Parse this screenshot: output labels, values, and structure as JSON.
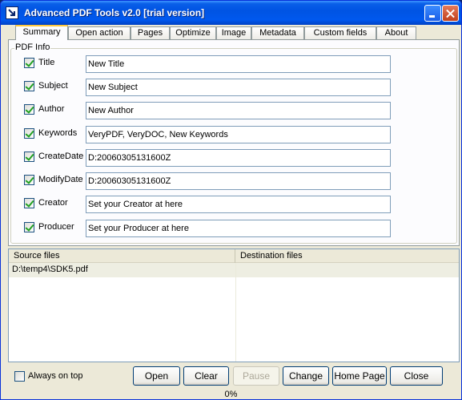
{
  "window": {
    "title": "Advanced PDF Tools  v2.0 [trial version]",
    "icons": [
      "app-icon",
      "minimize-icon",
      "close-icon"
    ]
  },
  "tabs": [
    {
      "label": "Summary",
      "active": true
    },
    {
      "label": "Open action",
      "active": false
    },
    {
      "label": "Pages",
      "active": false
    },
    {
      "label": "Optimize",
      "active": false
    },
    {
      "label": "Image",
      "active": false
    },
    {
      "label": "Metadata",
      "active": false
    },
    {
      "label": "Custom fields",
      "active": false
    },
    {
      "label": "About",
      "active": false
    }
  ],
  "pdf_info": {
    "legend": "PDF Info",
    "fields": [
      {
        "label": "Title",
        "checked": true,
        "value": "New Title"
      },
      {
        "label": "Subject",
        "checked": true,
        "value": "New Subject"
      },
      {
        "label": "Author",
        "checked": true,
        "value": "New Author"
      },
      {
        "label": "Keywords",
        "checked": true,
        "value": "VeryPDF, VeryDOC, New Keywords"
      },
      {
        "label": "CreateDate",
        "checked": true,
        "value": "D:20060305131600Z"
      },
      {
        "label": "ModifyDate",
        "checked": true,
        "value": "D:20060305131600Z"
      },
      {
        "label": "Creator",
        "checked": true,
        "value": "Set your Creator at here"
      },
      {
        "label": "Producer",
        "checked": true,
        "value": "Set your Producer at here"
      }
    ]
  },
  "files": {
    "columns": [
      "Source files",
      "Destination files"
    ],
    "rows": [
      [
        "D:\\temp4\\SDK5.pdf",
        ""
      ]
    ]
  },
  "always_on_top": {
    "label": "Always on top",
    "checked": false
  },
  "buttons": [
    {
      "label": "Open",
      "enabled": true
    },
    {
      "label": "Clear",
      "enabled": true
    },
    {
      "label": "Pause",
      "enabled": false
    },
    {
      "label": "Change",
      "enabled": true
    },
    {
      "label": "Home Page",
      "enabled": true
    },
    {
      "label": "Close",
      "enabled": true
    }
  ],
  "status": {
    "progress_text": "0%"
  },
  "colors": {
    "titlebar": "#0054e3",
    "face": "#ece9d8",
    "tab_highlight": "#ffc83c"
  }
}
